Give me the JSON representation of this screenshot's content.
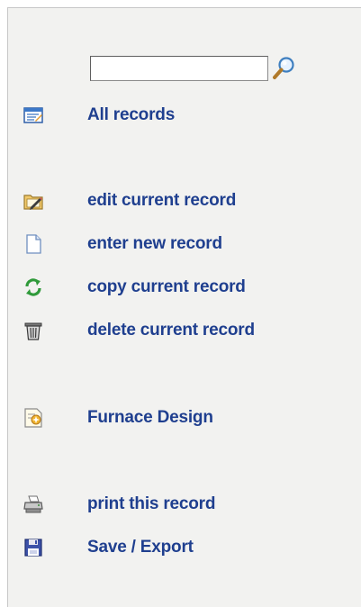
{
  "search": {
    "value": "",
    "placeholder": "",
    "icon": "magnifier-icon"
  },
  "menu": {
    "all_records": {
      "label": "All records",
      "icon": "records-list-icon"
    },
    "edit": {
      "label": "edit current record",
      "icon": "edit-icon"
    },
    "new": {
      "label": "enter new record",
      "icon": "new-document-icon"
    },
    "copy": {
      "label": "copy current record",
      "icon": "copy-refresh-icon"
    },
    "delete": {
      "label": "delete current record",
      "icon": "trash-icon"
    },
    "furnace": {
      "label": "Furnace Design",
      "icon": "design-document-icon"
    },
    "print": {
      "label": "print this record",
      "icon": "printer-icon"
    },
    "save": {
      "label": "Save / Export",
      "icon": "floppy-disk-icon"
    }
  },
  "colors": {
    "link": "#1f3f8f",
    "panel_bg": "#f2f2f0"
  }
}
